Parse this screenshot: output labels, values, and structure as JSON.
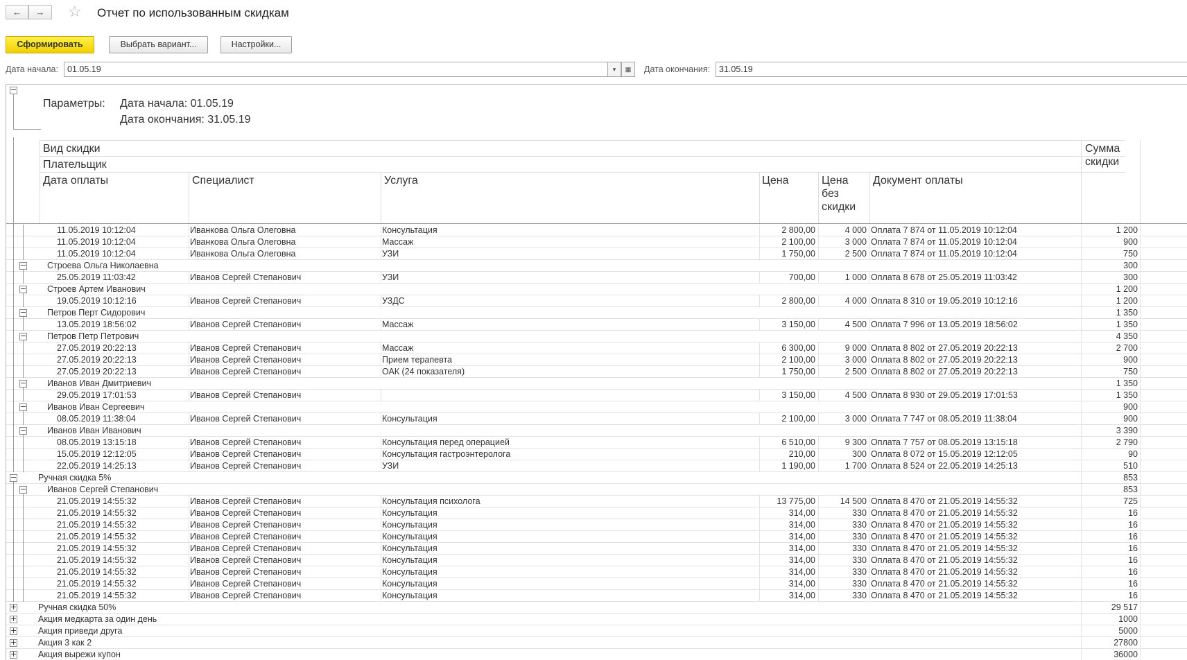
{
  "window": {
    "title": "Отчет по использованным скидкам",
    "back_icon": "←",
    "forward_icon": "→",
    "star_icon": "☆"
  },
  "toolbar": {
    "generate_label": "Сформировать",
    "variant_label": "Выбрать вариант...",
    "settings_label": "Настройки..."
  },
  "filters": {
    "start_label": "Дата начала:",
    "start_value": "01.05.19",
    "end_label": "Дата окончания:",
    "end_value": "31.05.19",
    "dropdown_icon": "▾",
    "calendar_icon": "▦"
  },
  "report": {
    "params_label": "Параметры:",
    "param_start": "Дата начала: 01.05.19",
    "param_end": "Дата окончания: 31.05.19",
    "header": {
      "group1": "Вид скидки",
      "group2": "Плательщик",
      "date": "Дата оплаты",
      "specialist": "Специалист",
      "service": "Услуга",
      "price": "Цена",
      "price_full_1": "Цена",
      "price_full_2": "без",
      "price_full_3": "скидки",
      "document": "Документ оплаты",
      "sum_1": "Сумма",
      "sum_2": "скидки"
    },
    "rows": [
      {
        "level": "d",
        "date": "11.05.2019 10:12:04",
        "spec": "Иванкова Ольга Олеговна",
        "service": "Консультация",
        "price": "2 800,00",
        "full": "4 000",
        "doc": "Оплата 7 874 от 11.05.2019 10:12:04",
        "sum": "1 200"
      },
      {
        "level": "d",
        "date": "11.05.2019 10:12:04",
        "spec": "Иванкова Ольга Олеговна",
        "service": "Массаж",
        "price": "2 100,00",
        "full": "3 000",
        "doc": "Оплата 7 874 от 11.05.2019 10:12:04",
        "sum": "900"
      },
      {
        "level": "d",
        "date": "11.05.2019 10:12:04",
        "spec": "Иванкова Ольга Олеговна",
        "service": "УЗИ",
        "price": "1 750,00",
        "full": "2 500",
        "doc": "Оплата 7 874 от 11.05.2019 10:12:04",
        "sum": "750"
      },
      {
        "level": "p",
        "name": "Строева Ольга Николаевна",
        "sum": "300",
        "toggle": "−"
      },
      {
        "level": "d",
        "date": "25.05.2019 11:03:42",
        "spec": "Иванов Сергей Степанович",
        "service": "УЗИ",
        "price": "700,00",
        "full": "1 000",
        "doc": "Оплата 8 678 от 25.05.2019 11:03:42",
        "sum": "300"
      },
      {
        "level": "p",
        "name": "Строев Артем Иванович",
        "sum": "1 200",
        "toggle": "−"
      },
      {
        "level": "d",
        "date": "19.05.2019 10:12:16",
        "spec": "Иванов Сергей Степанович",
        "service": "УЗДС",
        "price": "2 800,00",
        "full": "4 000",
        "doc": "Оплата 8 310 от 19.05.2019 10:12:16",
        "sum": "1 200"
      },
      {
        "level": "p",
        "name": "Петров Перт Сидорович",
        "sum": "1 350",
        "toggle": "−"
      },
      {
        "level": "d",
        "date": "13.05.2019 18:56:02",
        "spec": "Иванов Сергей Степанович",
        "service": "Массаж",
        "price": "3 150,00",
        "full": "4 500",
        "doc": "Оплата 7 996 от 13.05.2019 18:56:02",
        "sum": "1 350"
      },
      {
        "level": "p",
        "name": "Петров Петр Петрович",
        "sum": "4 350",
        "toggle": "−"
      },
      {
        "level": "d",
        "date": "27.05.2019 20:22:13",
        "spec": "Иванов Сергей Степанович",
        "service": "Массаж",
        "price": "6 300,00",
        "full": "9 000",
        "doc": "Оплата 8 802 от 27.05.2019 20:22:13",
        "sum": "2 700"
      },
      {
        "level": "d",
        "date": "27.05.2019 20:22:13",
        "spec": "Иванов Сергей Степанович",
        "service": "Прием терапевта",
        "price": "2 100,00",
        "full": "3 000",
        "doc": "Оплата 8 802 от 27.05.2019 20:22:13",
        "sum": "900"
      },
      {
        "level": "d",
        "date": "27.05.2019 20:22:13",
        "spec": "Иванов Сергей Степанович",
        "service": "ОАК (24 показателя)",
        "price": "1 750,00",
        "full": "2 500",
        "doc": "Оплата 8 802 от 27.05.2019 20:22:13",
        "sum": "750"
      },
      {
        "level": "p",
        "name": "Иванов Иван Дмитриевич",
        "sum": "1 350",
        "toggle": "−"
      },
      {
        "level": "d",
        "date": "29.05.2019 17:01:53",
        "spec": "Иванов Сергей Степанович",
        "service": "",
        "price": "3 150,00",
        "full": "4 500",
        "doc": "Оплата 8 930 от 29.05.2019 17:01:53",
        "sum": "1 350"
      },
      {
        "level": "p",
        "name": "Иванов Иван Сергеевич",
        "sum": "900",
        "toggle": "−"
      },
      {
        "level": "d",
        "date": "08.05.2019 11:38:04",
        "spec": "Иванов Сергей Степанович",
        "service": "Консультация",
        "price": "2 100,00",
        "full": "3 000",
        "doc": "Оплата 7 747 от 08.05.2019 11:38:04",
        "sum": "900"
      },
      {
        "level": "p",
        "name": "Иванов Иван Иванович",
        "sum": "3 390",
        "toggle": "−"
      },
      {
        "level": "d",
        "date": "08.05.2019 13:15:18",
        "spec": "Иванов Сергей Степанович",
        "service": "Консультация перед операцией",
        "price": "6 510,00",
        "full": "9 300",
        "doc": "Оплата 7 757 от 08.05.2019 13:15:18",
        "sum": "2 790"
      },
      {
        "level": "d",
        "date": "15.05.2019 12:12:05",
        "spec": "Иванов Сергей Степанович",
        "service": "Консультация гастроэнтеролога",
        "price": "210,00",
        "full": "300",
        "doc": "Оплата 8 072 от 15.05.2019 12:12:05",
        "sum": "90"
      },
      {
        "level": "d",
        "date": "22.05.2019 14:25:13",
        "spec": "Иванов Сергей Степанович",
        "service": "УЗИ",
        "price": "1 190,00",
        "full": "1 700",
        "doc": "Оплата 8 524 от 22.05.2019 14:25:13",
        "sum": "510"
      },
      {
        "level": "g",
        "name": "Ручная скидка 5%",
        "sum": "853",
        "toggle": "−"
      },
      {
        "level": "p",
        "name": "Иванов Сергей Степанович",
        "sum": "853",
        "toggle": "−"
      },
      {
        "level": "d",
        "date": "21.05.2019 14:55:32",
        "spec": "Иванов Сергей Степанович",
        "service": "Консультация психолога",
        "price": "13 775,00",
        "full": "14 500",
        "doc": "Оплата 8 470 от 21.05.2019 14:55:32",
        "sum": "725"
      },
      {
        "level": "d",
        "date": "21.05.2019 14:55:32",
        "spec": "Иванов Сергей Степанович",
        "service": "Консультация",
        "price": "314,00",
        "full": "330",
        "doc": "Оплата 8 470 от 21.05.2019 14:55:32",
        "sum": "16"
      },
      {
        "level": "d",
        "date": "21.05.2019 14:55:32",
        "spec": "Иванов Сергей Степанович",
        "service": "Консультация",
        "price": "314,00",
        "full": "330",
        "doc": "Оплата 8 470 от 21.05.2019 14:55:32",
        "sum": "16"
      },
      {
        "level": "d",
        "date": "21.05.2019 14:55:32",
        "spec": "Иванов Сергей Степанович",
        "service": "Консультация",
        "price": "314,00",
        "full": "330",
        "doc": "Оплата 8 470 от 21.05.2019 14:55:32",
        "sum": "16"
      },
      {
        "level": "d",
        "date": "21.05.2019 14:55:32",
        "spec": "Иванов Сергей Степанович",
        "service": "Консультация",
        "price": "314,00",
        "full": "330",
        "doc": "Оплата 8 470 от 21.05.2019 14:55:32",
        "sum": "16"
      },
      {
        "level": "d",
        "date": "21.05.2019 14:55:32",
        "spec": "Иванов Сергей Степанович",
        "service": "Консультация",
        "price": "314,00",
        "full": "330",
        "doc": "Оплата 8 470 от 21.05.2019 14:55:32",
        "sum": "16"
      },
      {
        "level": "d",
        "date": "21.05.2019 14:55:32",
        "spec": "Иванов Сергей Степанович",
        "service": "Консультация",
        "price": "314,00",
        "full": "330",
        "doc": "Оплата 8 470 от 21.05.2019 14:55:32",
        "sum": "16"
      },
      {
        "level": "d",
        "date": "21.05.2019 14:55:32",
        "spec": "Иванов Сергей Степанович",
        "service": "Консультация",
        "price": "314,00",
        "full": "330",
        "doc": "Оплата 8 470 от 21.05.2019 14:55:32",
        "sum": "16"
      },
      {
        "level": "d",
        "date": "21.05.2019 14:55:32",
        "spec": "Иванов Сергей Степанович",
        "service": "Консультация",
        "price": "314,00",
        "full": "330",
        "doc": "Оплата 8 470 от 21.05.2019 14:55:32",
        "sum": "16"
      },
      {
        "level": "g",
        "name": "Ручная скидка 50%",
        "sum": "29 517",
        "toggle": "+"
      },
      {
        "level": "g",
        "name": "Акция медкарта за один день",
        "sum": "1000",
        "toggle": "+"
      },
      {
        "level": "g",
        "name": "Акция приведи друга",
        "sum": "5000",
        "toggle": "+"
      },
      {
        "level": "g",
        "name": "Акция 3 как 2",
        "sum": "27800",
        "toggle": "+"
      },
      {
        "level": "g",
        "name": "Акция вырежи купон",
        "sum": "36000",
        "toggle": "+"
      }
    ]
  }
}
